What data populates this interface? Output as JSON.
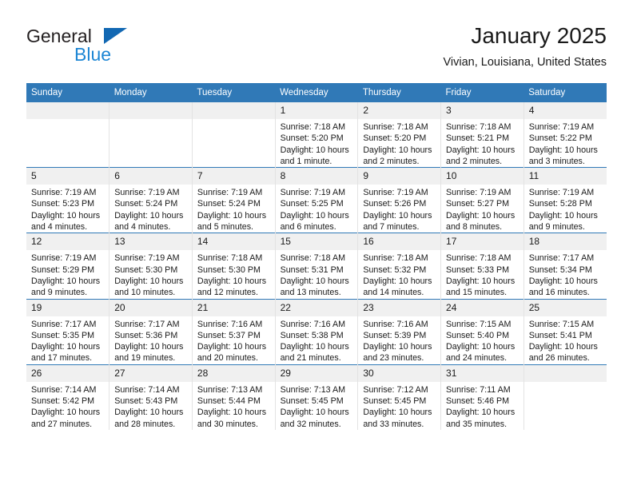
{
  "brand": {
    "word1": "General",
    "word2": "Blue",
    "triangle_color": "#1268b3",
    "blue_text_color": "#1d86d4"
  },
  "header": {
    "title": "January 2025",
    "subtitle": "Vivian, Louisiana, United States"
  },
  "theme": {
    "header_blue": "#3079b7",
    "daynum_band": "#f0f0f0",
    "text": "#1a1a1a"
  },
  "calendar": {
    "weekday_headers": [
      "Sunday",
      "Monday",
      "Tuesday",
      "Wednesday",
      "Thursday",
      "Friday",
      "Saturday"
    ],
    "weeks": [
      [
        {
          "day": "",
          "lines": []
        },
        {
          "day": "",
          "lines": []
        },
        {
          "day": "",
          "lines": []
        },
        {
          "day": "1",
          "lines": [
            "Sunrise: 7:18 AM",
            "Sunset: 5:20 PM",
            "Daylight: 10 hours",
            "and 1 minute."
          ]
        },
        {
          "day": "2",
          "lines": [
            "Sunrise: 7:18 AM",
            "Sunset: 5:20 PM",
            "Daylight: 10 hours",
            "and 2 minutes."
          ]
        },
        {
          "day": "3",
          "lines": [
            "Sunrise: 7:18 AM",
            "Sunset: 5:21 PM",
            "Daylight: 10 hours",
            "and 2 minutes."
          ]
        },
        {
          "day": "4",
          "lines": [
            "Sunrise: 7:19 AM",
            "Sunset: 5:22 PM",
            "Daylight: 10 hours",
            "and 3 minutes."
          ]
        }
      ],
      [
        {
          "day": "5",
          "lines": [
            "Sunrise: 7:19 AM",
            "Sunset: 5:23 PM",
            "Daylight: 10 hours",
            "and 4 minutes."
          ]
        },
        {
          "day": "6",
          "lines": [
            "Sunrise: 7:19 AM",
            "Sunset: 5:24 PM",
            "Daylight: 10 hours",
            "and 4 minutes."
          ]
        },
        {
          "day": "7",
          "lines": [
            "Sunrise: 7:19 AM",
            "Sunset: 5:24 PM",
            "Daylight: 10 hours",
            "and 5 minutes."
          ]
        },
        {
          "day": "8",
          "lines": [
            "Sunrise: 7:19 AM",
            "Sunset: 5:25 PM",
            "Daylight: 10 hours",
            "and 6 minutes."
          ]
        },
        {
          "day": "9",
          "lines": [
            "Sunrise: 7:19 AM",
            "Sunset: 5:26 PM",
            "Daylight: 10 hours",
            "and 7 minutes."
          ]
        },
        {
          "day": "10",
          "lines": [
            "Sunrise: 7:19 AM",
            "Sunset: 5:27 PM",
            "Daylight: 10 hours",
            "and 8 minutes."
          ]
        },
        {
          "day": "11",
          "lines": [
            "Sunrise: 7:19 AM",
            "Sunset: 5:28 PM",
            "Daylight: 10 hours",
            "and 9 minutes."
          ]
        }
      ],
      [
        {
          "day": "12",
          "lines": [
            "Sunrise: 7:19 AM",
            "Sunset: 5:29 PM",
            "Daylight: 10 hours",
            "and 9 minutes."
          ]
        },
        {
          "day": "13",
          "lines": [
            "Sunrise: 7:19 AM",
            "Sunset: 5:30 PM",
            "Daylight: 10 hours",
            "and 10 minutes."
          ]
        },
        {
          "day": "14",
          "lines": [
            "Sunrise: 7:18 AM",
            "Sunset: 5:30 PM",
            "Daylight: 10 hours",
            "and 12 minutes."
          ]
        },
        {
          "day": "15",
          "lines": [
            "Sunrise: 7:18 AM",
            "Sunset: 5:31 PM",
            "Daylight: 10 hours",
            "and 13 minutes."
          ]
        },
        {
          "day": "16",
          "lines": [
            "Sunrise: 7:18 AM",
            "Sunset: 5:32 PM",
            "Daylight: 10 hours",
            "and 14 minutes."
          ]
        },
        {
          "day": "17",
          "lines": [
            "Sunrise: 7:18 AM",
            "Sunset: 5:33 PM",
            "Daylight: 10 hours",
            "and 15 minutes."
          ]
        },
        {
          "day": "18",
          "lines": [
            "Sunrise: 7:17 AM",
            "Sunset: 5:34 PM",
            "Daylight: 10 hours",
            "and 16 minutes."
          ]
        }
      ],
      [
        {
          "day": "19",
          "lines": [
            "Sunrise: 7:17 AM",
            "Sunset: 5:35 PM",
            "Daylight: 10 hours",
            "and 17 minutes."
          ]
        },
        {
          "day": "20",
          "lines": [
            "Sunrise: 7:17 AM",
            "Sunset: 5:36 PM",
            "Daylight: 10 hours",
            "and 19 minutes."
          ]
        },
        {
          "day": "21",
          "lines": [
            "Sunrise: 7:16 AM",
            "Sunset: 5:37 PM",
            "Daylight: 10 hours",
            "and 20 minutes."
          ]
        },
        {
          "day": "22",
          "lines": [
            "Sunrise: 7:16 AM",
            "Sunset: 5:38 PM",
            "Daylight: 10 hours",
            "and 21 minutes."
          ]
        },
        {
          "day": "23",
          "lines": [
            "Sunrise: 7:16 AM",
            "Sunset: 5:39 PM",
            "Daylight: 10 hours",
            "and 23 minutes."
          ]
        },
        {
          "day": "24",
          "lines": [
            "Sunrise: 7:15 AM",
            "Sunset: 5:40 PM",
            "Daylight: 10 hours",
            "and 24 minutes."
          ]
        },
        {
          "day": "25",
          "lines": [
            "Sunrise: 7:15 AM",
            "Sunset: 5:41 PM",
            "Daylight: 10 hours",
            "and 26 minutes."
          ]
        }
      ],
      [
        {
          "day": "26",
          "lines": [
            "Sunrise: 7:14 AM",
            "Sunset: 5:42 PM",
            "Daylight: 10 hours",
            "and 27 minutes."
          ]
        },
        {
          "day": "27",
          "lines": [
            "Sunrise: 7:14 AM",
            "Sunset: 5:43 PM",
            "Daylight: 10 hours",
            "and 28 minutes."
          ]
        },
        {
          "day": "28",
          "lines": [
            "Sunrise: 7:13 AM",
            "Sunset: 5:44 PM",
            "Daylight: 10 hours",
            "and 30 minutes."
          ]
        },
        {
          "day": "29",
          "lines": [
            "Sunrise: 7:13 AM",
            "Sunset: 5:45 PM",
            "Daylight: 10 hours",
            "and 32 minutes."
          ]
        },
        {
          "day": "30",
          "lines": [
            "Sunrise: 7:12 AM",
            "Sunset: 5:45 PM",
            "Daylight: 10 hours",
            "and 33 minutes."
          ]
        },
        {
          "day": "31",
          "lines": [
            "Sunrise: 7:11 AM",
            "Sunset: 5:46 PM",
            "Daylight: 10 hours",
            "and 35 minutes."
          ]
        },
        {
          "day": "",
          "lines": []
        }
      ]
    ]
  }
}
